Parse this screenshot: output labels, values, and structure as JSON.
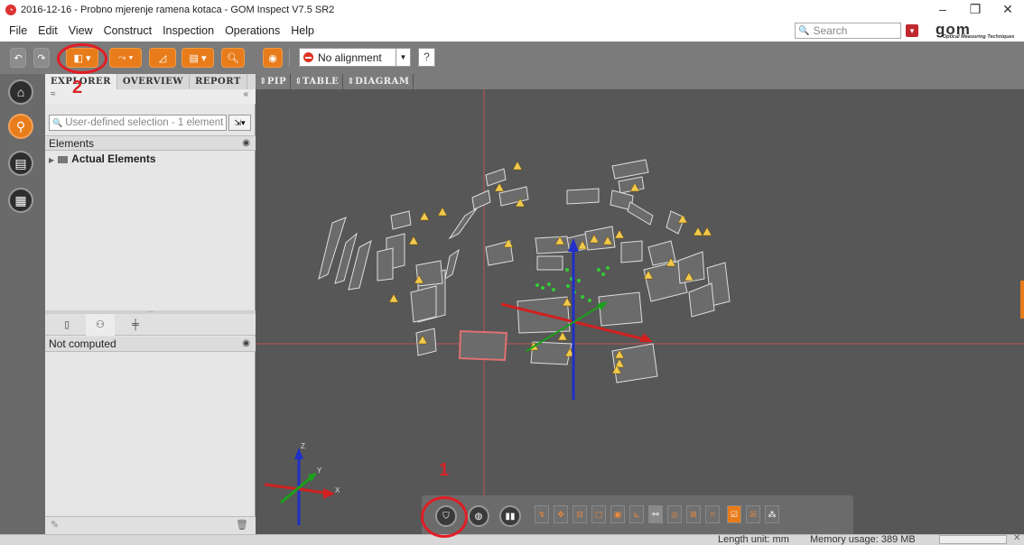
{
  "window": {
    "title": "2016-12-16 - Probno mjerenje ramena kotaca - GOM Inspect V7.5 SR2",
    "app_icon": "gom-icon",
    "controls": [
      "–",
      "❐",
      "✕"
    ]
  },
  "menu": [
    "File",
    "Edit",
    "View",
    "Construct",
    "Inspection",
    "Operations",
    "Help"
  ],
  "search": {
    "placeholder": "Search"
  },
  "logo": {
    "text": "gom",
    "tagline": "Optical Measuring Techniques"
  },
  "toolbar": {
    "alignment": "No alignment",
    "help": "?"
  },
  "sidebar_nav": [
    "home-icon",
    "search-icon",
    "report-icon",
    "grid-icon"
  ],
  "explorer": {
    "tabs": [
      "EXPLORER",
      "OVERVIEW",
      "REPORT"
    ],
    "collapse": "«",
    "expand": "≈",
    "selection": "User-defined selection - 1 element",
    "elements_header": "Elements",
    "tree_item": "Actual Elements",
    "properties_status": "Not computed"
  },
  "view_tabs": [
    "⇕PIP",
    "⇕TABLE",
    "⇕DIAGRAM"
  ],
  "axes": {
    "x": "X",
    "y": "Y",
    "z": "Z"
  },
  "status": {
    "length_unit": "Length unit: mm",
    "memory": "Memory usage: 389 MB"
  },
  "annotations": {
    "marker_1": "1",
    "marker_2": "2"
  },
  "colors": {
    "accent": "#e87c1a",
    "highlight_red": "#e11d24",
    "viewport_bg": "#575757"
  }
}
